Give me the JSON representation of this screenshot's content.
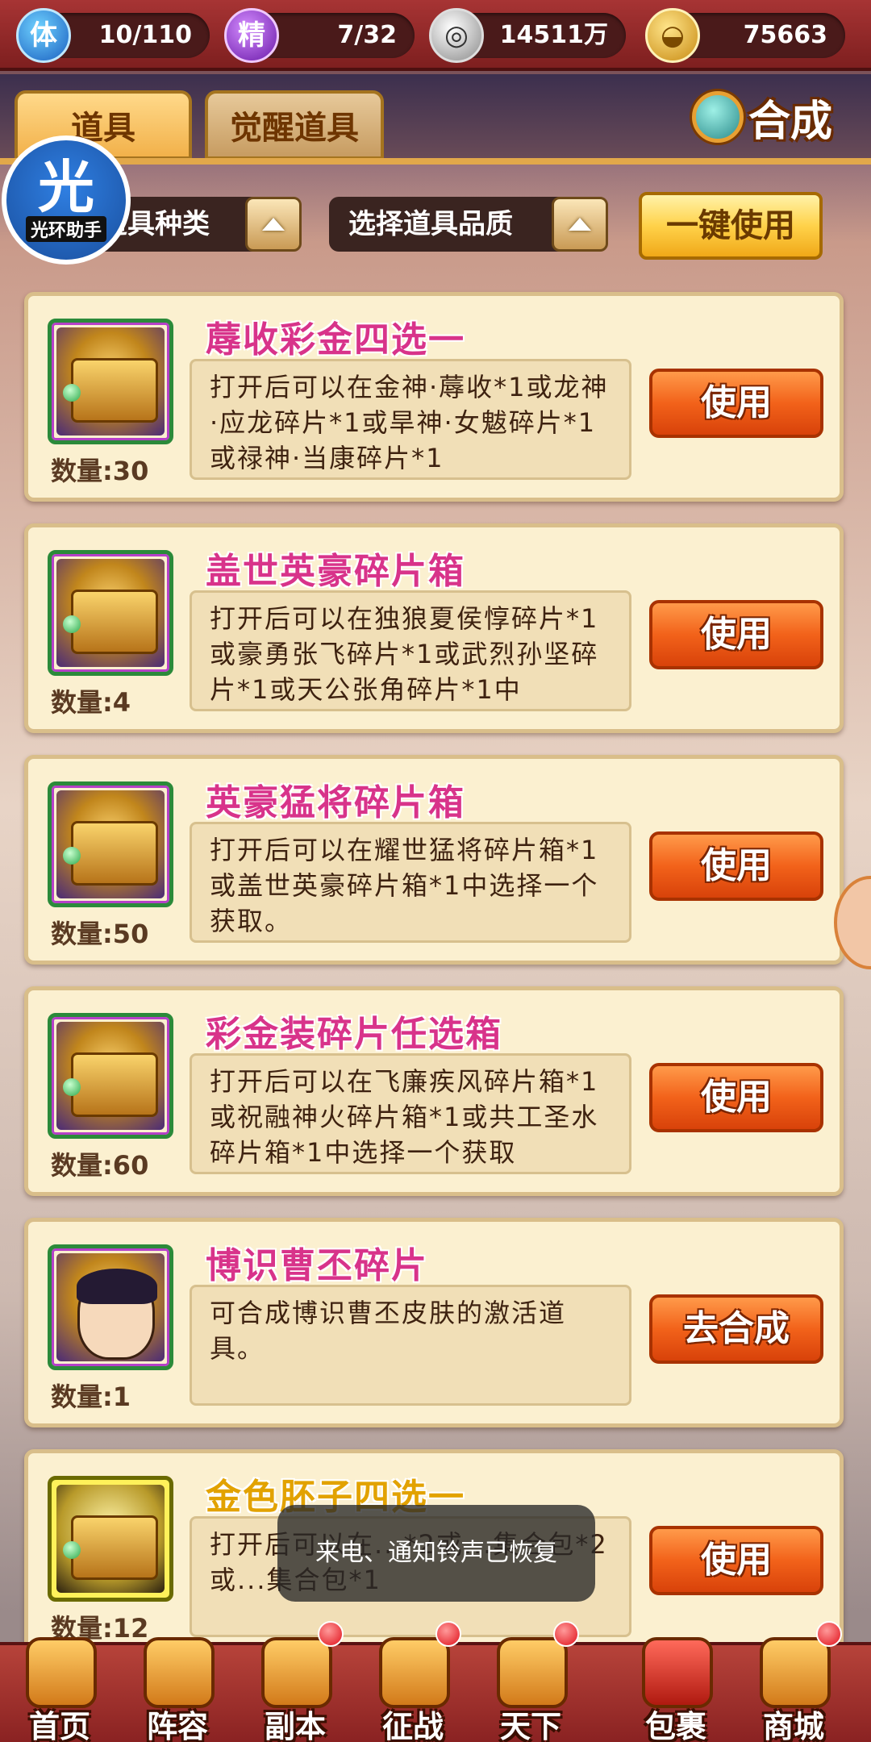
{
  "resources": [
    {
      "icon": "stamina-icon",
      "glyph": "体",
      "value": "10/110"
    },
    {
      "icon": "spirit-icon",
      "glyph": "精",
      "value": "7/32"
    },
    {
      "icon": "coin-icon",
      "glyph": "",
      "value": "14511万"
    },
    {
      "icon": "gold-ingot-icon",
      "glyph": "",
      "value": "75663"
    }
  ],
  "tabs": [
    {
      "label": "道具",
      "active": true
    },
    {
      "label": "觉醒道具",
      "active": false
    }
  ],
  "synthesis": {
    "label": "合成"
  },
  "helper": {
    "glyph": "光",
    "label": "光环助手"
  },
  "filters": {
    "type_label": "道具种类",
    "quality_label": "选择道具品质",
    "use_all_label": "一键使用"
  },
  "items": [
    {
      "name": "蓐收彩金四选一",
      "qty": "数量:30",
      "desc": "打开后可以在金神·蓐收*1或龙神·应龙碎片*1或旱神·女魃碎片*1或禄神·当康碎片*1",
      "button": "使用"
    },
    {
      "name": "盖世英豪碎片箱",
      "qty": "数量:4",
      "desc": "打开后可以在独狼夏侯惇碎片*1或豪勇张飞碎片*1或武烈孙坚碎片*1或天公张角碎片*1中",
      "button": "使用"
    },
    {
      "name": "英豪猛将碎片箱",
      "qty": "数量:50",
      "desc": "打开后可以在耀世猛将碎片箱*1或盖世英豪碎片箱*1中选择一个获取。",
      "button": "使用"
    },
    {
      "name": "彩金装碎片任选箱",
      "qty": "数量:60",
      "desc": "打开后可以在飞廉疾风碎片箱*1或祝融神火碎片箱*1或共工圣水碎片箱*1中选择一个获取",
      "button": "使用"
    },
    {
      "name": "博识曹丕碎片",
      "qty": "数量:1",
      "desc": "可合成博识曹丕皮肤的激活道具。",
      "button": "去合成"
    },
    {
      "name": "金色胚子四选一",
      "qty": "数量:12",
      "desc": "打开后可以在...*2或...集合包*2或...集合包*1",
      "button": "使用"
    }
  ],
  "toast": {
    "text": "来电、通知铃声已恢复"
  },
  "nav": [
    {
      "label": "首页",
      "badge": false,
      "active": false
    },
    {
      "label": "阵容",
      "badge": false,
      "active": false
    },
    {
      "label": "副本",
      "badge": true,
      "active": false
    },
    {
      "label": "征战",
      "badge": true,
      "active": false
    },
    {
      "label": "天下",
      "badge": true,
      "active": false
    },
    {
      "label": "包裹",
      "badge": false,
      "active": true
    },
    {
      "label": "商城",
      "badge": true,
      "active": false
    }
  ]
}
